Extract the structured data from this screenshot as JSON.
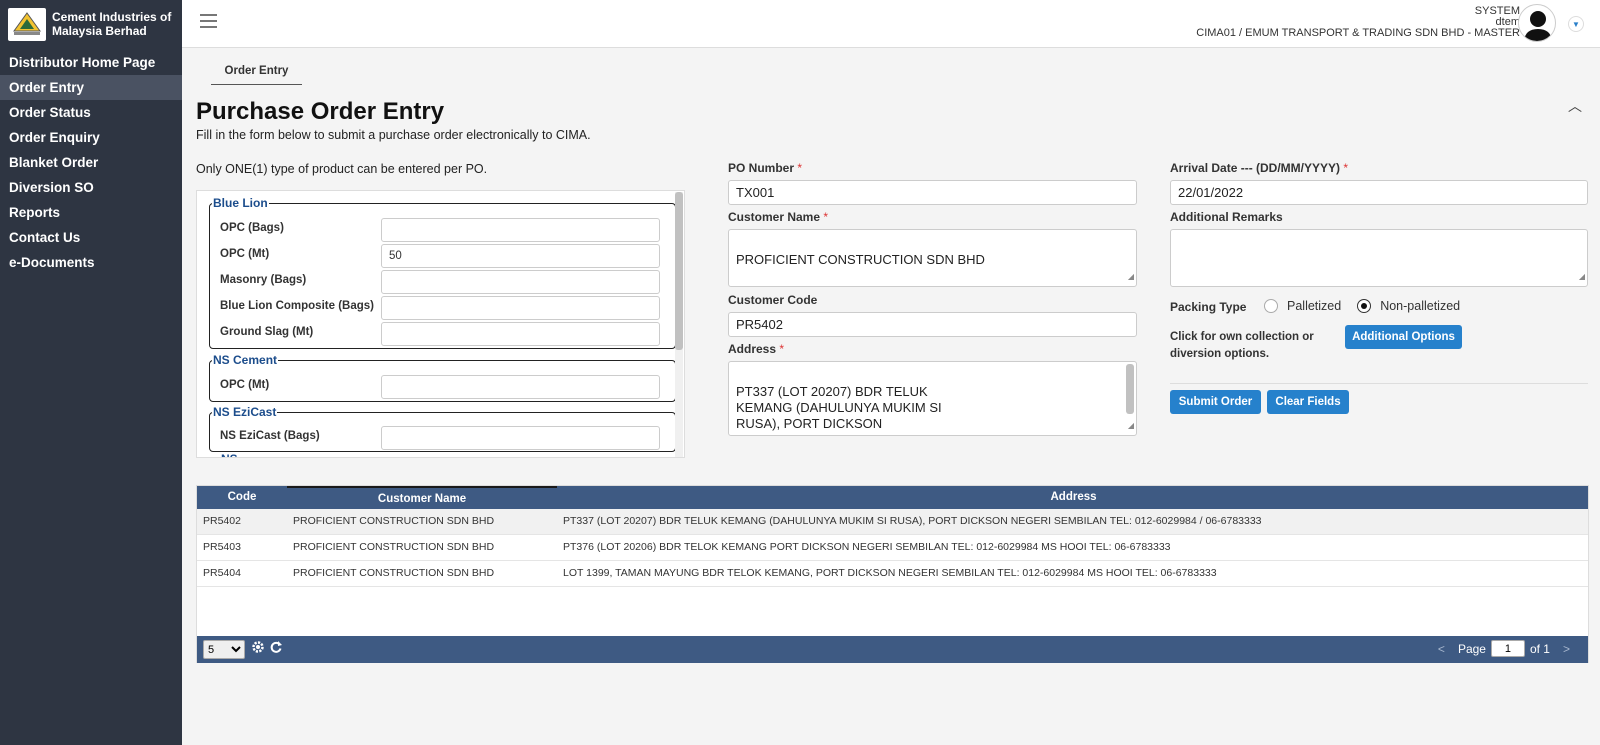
{
  "brand": {
    "line1": "Cement Industries of",
    "line2": "Malaysia Berhad"
  },
  "sidebar": {
    "items": [
      {
        "label": "Distributor Home Page",
        "active": false
      },
      {
        "label": "Order Entry",
        "active": true
      },
      {
        "label": "Order Status",
        "active": false
      },
      {
        "label": "Order Enquiry",
        "active": false
      },
      {
        "label": "Blanket Order",
        "active": false
      },
      {
        "label": "Diversion SO",
        "active": false
      },
      {
        "label": "Reports",
        "active": false
      },
      {
        "label": "Contact Us",
        "active": false
      },
      {
        "label": "e-Documents",
        "active": false
      }
    ]
  },
  "user": {
    "role": "SYSTEM",
    "name": "dtem",
    "company": "CIMA01 / EMUM TRANSPORT & TRADING SDN BHD - MASTER"
  },
  "tab": {
    "label": "Order Entry"
  },
  "page": {
    "title": "Purchase Order Entry",
    "subtitle": "Fill in the form below to submit a purchase order electronically to CIMA.",
    "note": "Only ONE(1) type of product can be entered per PO."
  },
  "products": {
    "blue_lion": {
      "legend": "Blue Lion",
      "rows": [
        {
          "label": "OPC (Bags)",
          "value": ""
        },
        {
          "label": "OPC (Mt)",
          "value": "50"
        },
        {
          "label": "Masonry (Bags)",
          "value": ""
        },
        {
          "label": "Blue Lion Composite (Bags)",
          "value": ""
        },
        {
          "label": "Ground Slag (Mt)",
          "value": ""
        }
      ]
    },
    "ns_cement": {
      "legend": "NS Cement",
      "rows": [
        {
          "label": "OPC (Mt)",
          "value": ""
        }
      ]
    },
    "ns_ezicast": {
      "legend": "NS EziCast",
      "rows": [
        {
          "label": "NS EziCast (Bags)",
          "value": ""
        }
      ]
    },
    "next_legend_partial": "NS"
  },
  "form": {
    "po_number": {
      "label": "PO Number",
      "value": "TX001"
    },
    "customer_name": {
      "label": "Customer Name",
      "value": "PROFICIENT CONSTRUCTION SDN BHD"
    },
    "customer_code": {
      "label": "Customer Code",
      "value": "PR5402"
    },
    "address": {
      "label": "Address",
      "value": "PT337 (LOT 20207) BDR TELUK\nKEMANG (DAHULUNYA MUKIM SI\nRUSA), PORT DICKSON\nNEGERI SEMBILAN"
    },
    "arrival_date": {
      "label": "Arrival Date --- (DD/MM/YYYY)",
      "value": "22/01/2022"
    },
    "remarks": {
      "label": "Additional Remarks",
      "value": ""
    },
    "packing": {
      "label": "Packing Type",
      "options": [
        {
          "label": "Palletized",
          "checked": false
        },
        {
          "label": "Non-palletized",
          "checked": true
        }
      ]
    },
    "collection_note": "Click for own collection or diversion options.",
    "additional_options_label": "Additional Options",
    "submit_label": "Submit Order",
    "clear_label": "Clear Fields"
  },
  "grid": {
    "columns": [
      "Code",
      "Customer Name",
      "Address"
    ],
    "rows": [
      {
        "code": "PR5402",
        "name": "PROFICIENT CONSTRUCTION SDN BHD",
        "address": "PT337 (LOT 20207) BDR TELUK KEMANG (DAHULUNYA MUKIM SI RUSA), PORT DICKSON NEGERI SEMBILAN TEL: 012-6029984 / 06-6783333"
      },
      {
        "code": "PR5403",
        "name": "PROFICIENT CONSTRUCTION SDN BHD",
        "address": "PT376 (LOT 20206) BDR TELOK KEMANG PORT DICKSON NEGERI SEMBILAN TEL: 012-6029984 MS HOOI TEL: 06-6783333"
      },
      {
        "code": "PR5404",
        "name": "PROFICIENT CONSTRUCTION SDN BHD",
        "address": "LOT 1399, TAMAN MAYUNG BDR TELOK KEMANG, PORT DICKSON NEGERI SEMBILAN TEL: 012-6029984 MS HOOI TEL: 06-6783333"
      }
    ],
    "page_size": "5",
    "page_label": "Page",
    "page_current": "1",
    "page_of": "of 1"
  },
  "colors": {
    "sidebar": "#2e3542",
    "accent": "#2681cc",
    "grid_header": "#3e5a83",
    "legend": "#1c4d8c"
  }
}
